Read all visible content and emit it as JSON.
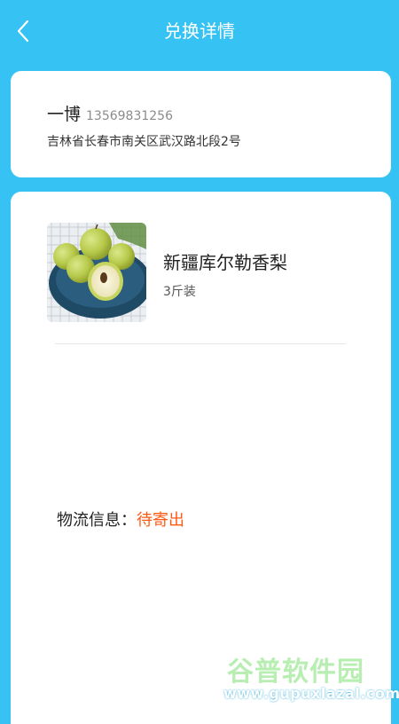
{
  "header": {
    "title": "兑换详情",
    "back_icon": "chevron-left-icon"
  },
  "address": {
    "name": "一博",
    "phone": "13569831256",
    "detail": "吉林省长春市南关区武汉路北段2号"
  },
  "product": {
    "name": "新疆库尔勒香梨",
    "spec": "3斤装",
    "image": "pear-product-image"
  },
  "logistics": {
    "label": "物流信息：",
    "status": "待寄出",
    "status_color": "#ff5a14"
  },
  "watermark": {
    "text": "谷普软件园",
    "url": "www.gupuxlazal.com"
  },
  "colors": {
    "accent": "#36c3f3"
  }
}
